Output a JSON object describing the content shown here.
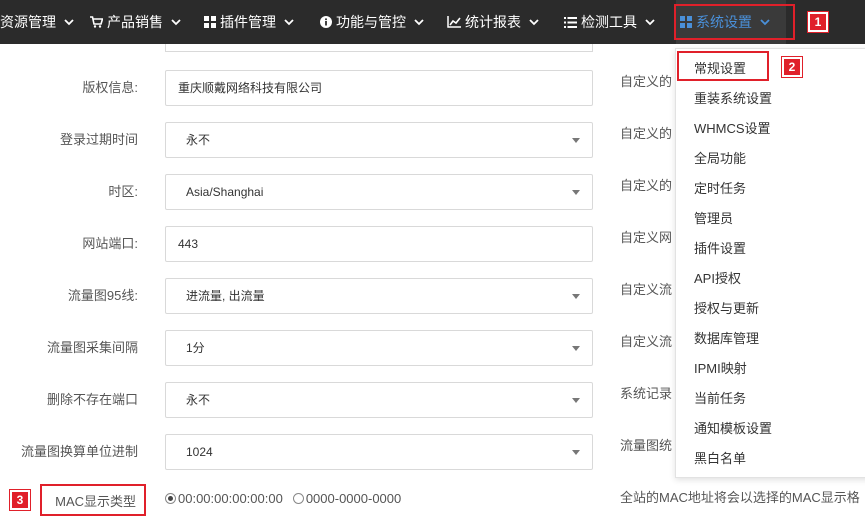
{
  "nav": {
    "items": [
      {
        "label": "资源管理",
        "icon": "none"
      },
      {
        "label": "产品销售",
        "icon": "cart-icon"
      },
      {
        "label": "插件管理",
        "icon": "grid-icon"
      },
      {
        "label": "功能与管控",
        "icon": "info-icon"
      },
      {
        "label": "统计报表",
        "icon": "chart-icon"
      },
      {
        "label": "检测工具",
        "icon": "list-icon"
      },
      {
        "label": "系统设置",
        "icon": "grid-icon"
      }
    ],
    "active_color": "#4a90d9"
  },
  "badges": {
    "one": "1",
    "two": "2",
    "three": "3"
  },
  "form": {
    "copyright": {
      "label": "版权信息:",
      "value": "重庆顺戴网络科技有限公司"
    },
    "login_expire": {
      "label": "登录过期时间",
      "value": "永不"
    },
    "timezone": {
      "label": "时区:",
      "value": "Asia/Shanghai"
    },
    "site_port": {
      "label": "网站端口:",
      "value": "443"
    },
    "traffic95": {
      "label": "流量图95线:",
      "value": "进流量, 出流量"
    },
    "traffic_interval": {
      "label": "流量图采集间隔",
      "value": "1分"
    },
    "delete_port": {
      "label": "删除不存在端口",
      "value": "永不"
    },
    "traffic_unit": {
      "label": "流量图换算单位进制",
      "value": "1024"
    },
    "mac": {
      "label": "MAC显示类型",
      "options": [
        "00:00:00:00:00:00",
        "0000-0000-0000"
      ],
      "selected": 0
    }
  },
  "right_texts": [
    "自定义的",
    "自定义的",
    "自定义的",
    "自定义网",
    "自定义流",
    "自定义流",
    "系统记录",
    "流量图统",
    "全站的MAC地址将会以选择的MAC显示格"
  ],
  "dropdown": {
    "items": [
      "常规设置",
      "重装系统设置",
      "WHMCS设置",
      "全局功能",
      "定时任务",
      "管理员",
      "插件设置",
      "API授权",
      "授权与更新",
      "数据库管理",
      "IPMI映射",
      "当前任务",
      "通知模板设置",
      "黑白名单"
    ]
  },
  "colors": {
    "nav_bg": "#2b2b2b",
    "highlight": "#e0202a",
    "border": "#d9d9d9"
  }
}
